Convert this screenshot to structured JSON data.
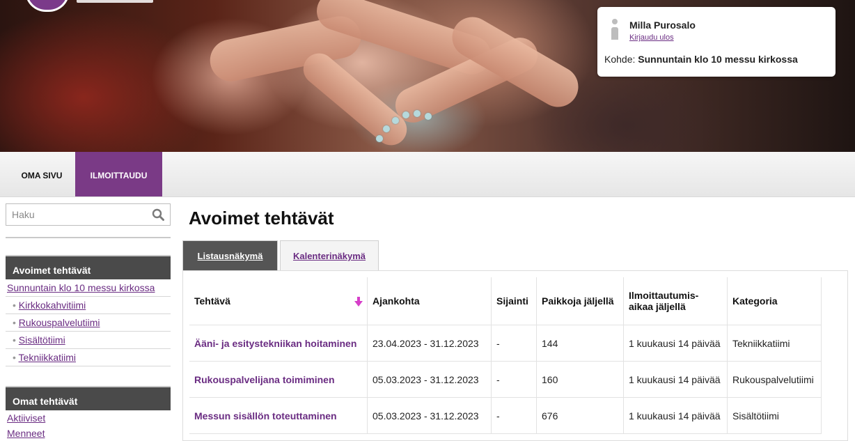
{
  "header": {
    "user_name": "Milla Purosalo",
    "logout_label": "Kirjaudu ulos",
    "target_label": "Kohde:",
    "target_value": "Sunnuntain klo 10 messu kirkossa"
  },
  "nav": {
    "tabs": [
      {
        "label": "OMA SIVU",
        "active": false
      },
      {
        "label": "ILMOITTAUDU",
        "active": true
      }
    ]
  },
  "sidebar": {
    "search_placeholder": "Haku",
    "open_tasks": {
      "title": "Avoimet tehtävät",
      "main_link": "Sunnuntain klo 10 messu kirkossa",
      "items": [
        "Kirkkokahvitiimi",
        "Rukouspalvelutiimi",
        "Sisältötiimi",
        "Tekniikkatiimi"
      ]
    },
    "own_tasks": {
      "title": "Omat tehtävät",
      "items": [
        "Aktiiviset",
        "Menneet"
      ]
    }
  },
  "main": {
    "title": "Avoimet tehtävät",
    "tabs": [
      "Listausnäkymä",
      "Kalenterinäkymä"
    ],
    "columns": [
      "Tehtävä",
      "Ajankohta",
      "Sijainti",
      "Paikkoja jäljellä",
      "Ilmoittautumis-aikaa jäljellä",
      "Kategoria"
    ],
    "rows": [
      {
        "task": "Ääni- ja esitystekniikan hoitaminen",
        "time": "23.04.2023 - 31.12.2023",
        "location": "-",
        "spots": "144",
        "remaining": "1 kuukausi 14 päivää",
        "category": "Tekniikkatiimi"
      },
      {
        "task": "Rukouspalvelijana toimiminen",
        "time": "05.03.2023 - 31.12.2023",
        "location": "-",
        "spots": "160",
        "remaining": "1 kuukausi 14 päivää",
        "category": "Rukouspalvelutiimi"
      },
      {
        "task": "Messun sisällön toteuttaminen",
        "time": "05.03.2023 - 31.12.2023",
        "location": "-",
        "spots": "676",
        "remaining": "1 kuukausi 14 päivää",
        "category": "Sisältötiimi"
      }
    ]
  },
  "colors": {
    "accent": "#7a3a86",
    "link": "#6a2c82",
    "sort_arrow": "#d63fc9"
  }
}
